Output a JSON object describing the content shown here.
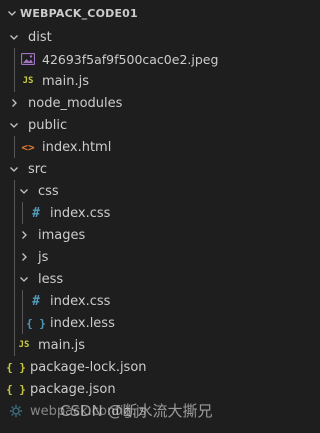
{
  "explorer": {
    "root_label": "WEBPACK_CODE01",
    "items": [
      {
        "label": "dist",
        "kind": "folder-open"
      },
      {
        "label": "42693f5af9f500cac0e2.jpeg",
        "kind": "image"
      },
      {
        "label": "main.js",
        "kind": "js"
      },
      {
        "label": "node_modules",
        "kind": "folder-closed"
      },
      {
        "label": "public",
        "kind": "folder-open"
      },
      {
        "label": "index.html",
        "kind": "html"
      },
      {
        "label": "src",
        "kind": "folder-open"
      },
      {
        "label": "css",
        "kind": "folder-open"
      },
      {
        "label": "index.css",
        "kind": "css"
      },
      {
        "label": "images",
        "kind": "folder-closed"
      },
      {
        "label": "js",
        "kind": "folder-closed"
      },
      {
        "label": "less",
        "kind": "folder-open"
      },
      {
        "label": "index.css",
        "kind": "css"
      },
      {
        "label": "index.less",
        "kind": "less"
      },
      {
        "label": "main.js",
        "kind": "js"
      },
      {
        "label": "package-lock.json",
        "kind": "json"
      },
      {
        "label": "package.json",
        "kind": "json"
      },
      {
        "label": "webpack.config.js",
        "kind": "config"
      }
    ]
  },
  "icons": {
    "js": "JS",
    "json": "{ }",
    "css": "#",
    "less": "{ }",
    "html": "<>"
  },
  "watermark": "CSDN @断水流大撕兄",
  "colors": {
    "background": "#1e1e1e",
    "text": "#cccccc",
    "js_icon": "#cbcb41",
    "css_icon": "#519aba",
    "html_icon": "#e37933",
    "image_icon": "#a074c4"
  }
}
